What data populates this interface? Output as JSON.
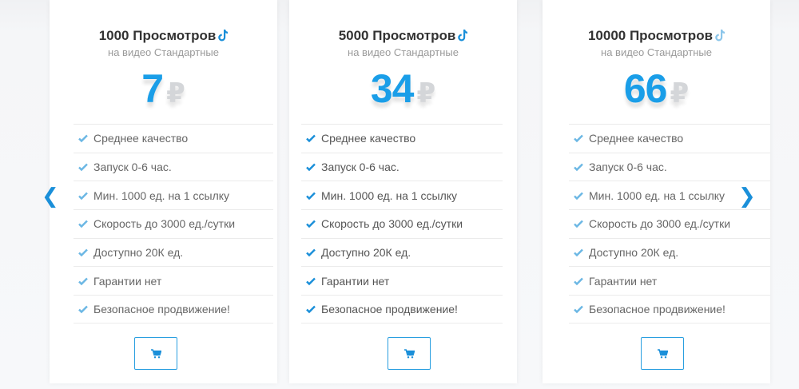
{
  "accent_color": "#1a9ee8",
  "nav": {
    "prev": "❮",
    "next": "❯"
  },
  "plans": [
    {
      "title": "1000 Просмотров",
      "subtitle": "на видео Стандартные",
      "price": "7",
      "currency": "₽",
      "features": [
        "Среднее качество",
        "Запуск 0-6 час.",
        "Мин. 1000 ед. на 1 ссылку",
        "Скорость до 3000 ед./сутки",
        "Доступно 20К ед.",
        "Гарантии нет",
        "Безопасное продвижение!"
      ],
      "icon": "tiktok-icon",
      "button_icon": "cart-icon"
    },
    {
      "title": "5000 Просмотров",
      "subtitle": "на видео Стандартные",
      "price": "34",
      "currency": "₽",
      "features": [
        "Среднее качество",
        "Запуск 0-6 час.",
        "Мин. 1000 ед. на 1 ссылку",
        "Скорость до 3000 ед./сутки",
        "Доступно 20К ед.",
        "Гарантии нет",
        "Безопасное продвижение!"
      ],
      "icon": "tiktok-icon",
      "button_icon": "cart-icon"
    },
    {
      "title": "10000 Просмотров",
      "subtitle": "на видео Стандартные",
      "price": "66",
      "currency": "₽",
      "features": [
        "Среднее качество",
        "Запуск 0-6 час.",
        "Мин. 1000 ед. на 1 ссылку",
        "Скорость до 3000 ед./сутки",
        "Доступно 20К ед.",
        "Гарантии нет",
        "Безопасное продвижение!"
      ],
      "icon": "tiktok-icon",
      "button_icon": "cart-icon"
    }
  ]
}
